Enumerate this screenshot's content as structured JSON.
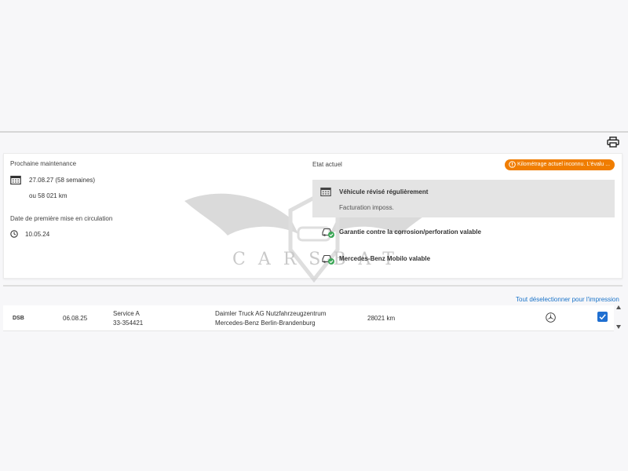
{
  "maintenance": {
    "heading": "Prochaine maintenance",
    "date": "27.08.27 (58 semaines)",
    "km": "ou 58 021 km",
    "first_reg_label": "Date de première mise en circulation",
    "first_reg_date": "10.05.24"
  },
  "status": {
    "heading": "Etat actuel",
    "alert": "Kilométrage actuel inconnu. L'évalu ...",
    "serviced_title": "Véhicule révisé régulièrement",
    "serviced_sub": "Facturation imposs.",
    "warranty": "Garantie contre la corrosion/perforation valable",
    "mobilo": "Mercedes-Benz Mobilo valable"
  },
  "list": {
    "deselect_all": "Tout déselectionner pour l'impression",
    "rows": [
      {
        "code": "DSB",
        "date": "06.08.25",
        "service": "Service A",
        "order": "33-354421",
        "dealer_line1": "Daimler Truck AG Nutzfahrzeugzentrum",
        "dealer_line2": "Mercedes-Benz Berlin-Brandenburg",
        "km": "28021 km",
        "checked": true
      }
    ]
  },
  "watermark": {
    "text": "CARSBAT"
  },
  "colors": {
    "accent": "#1f6fd1",
    "alert": "#f07d00",
    "ok": "#3aa655"
  },
  "icons": [
    "printer-icon",
    "calendar-icon",
    "clock-icon",
    "info-icon",
    "car-check-icon",
    "mercedes-star-icon",
    "chevron-up-icon",
    "chevron-down-icon",
    "checkmark-icon"
  ]
}
